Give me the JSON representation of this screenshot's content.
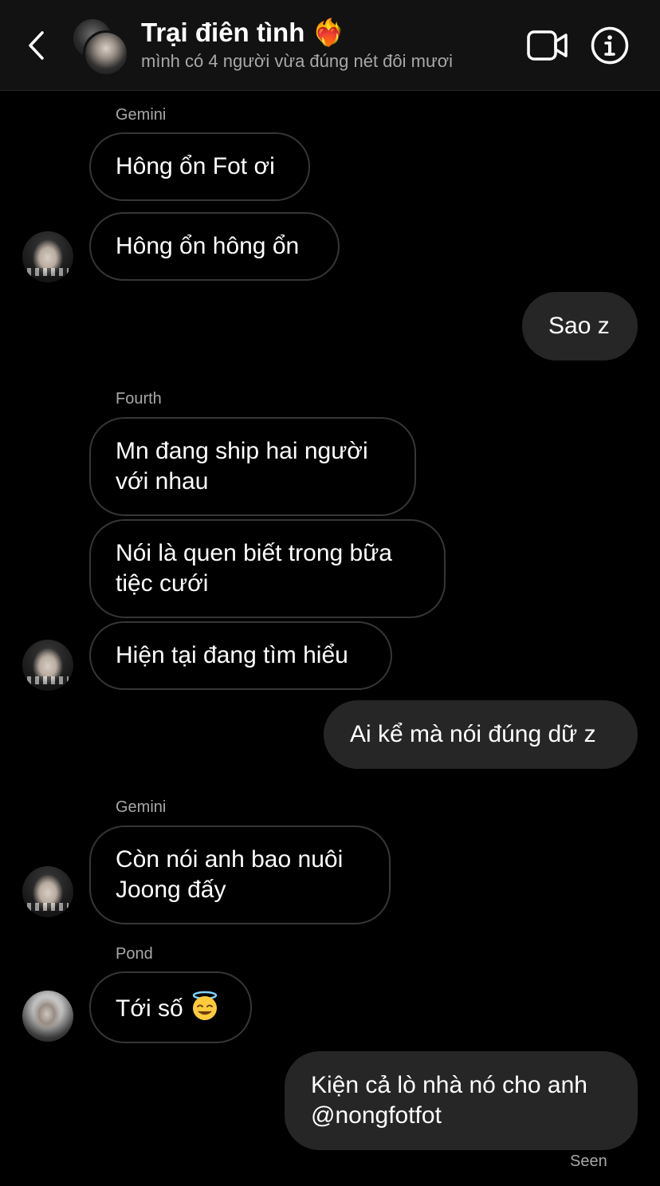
{
  "header": {
    "title": "Trại điên tình ❤️‍🔥",
    "subtitle": "mình có 4 người vừa đúng nét đôi mươi"
  },
  "messages": [
    {
      "sender": "Gemini",
      "text": "Hông ổn Fot ơi"
    },
    {
      "text": "Hông ổn hông ổn"
    },
    {
      "text": "Sao z"
    },
    {
      "sender": "Fourth",
      "line1": "Mn đang ship hai người",
      "line2": "với nhau"
    },
    {
      "line1": "Nói là quen biết trong bữa",
      "line2": "tiệc cưới"
    },
    {
      "text": "Hiện tại đang tìm hiểu"
    },
    {
      "text": "Ai kể mà nói đúng dữ z"
    },
    {
      "sender": "Gemini",
      "line1": "Còn nói anh bao nuôi",
      "line2": "Joong đấy"
    },
    {
      "sender": "Pond",
      "text": "Tới số"
    },
    {
      "line1": "Kiện cả lò nhà nó cho anh",
      "line2": "@nongfotfot"
    }
  ],
  "status": {
    "seen": "Seen"
  },
  "icons": {
    "back": "chevron-left-icon",
    "video": "video-camera-icon",
    "info": "info-icon",
    "emoji": "smiling-face-with-halo"
  },
  "colors": {
    "background": "#000000",
    "header": "#121212",
    "outgoing_bubble": "#262626",
    "incoming_border": "#363636",
    "secondary_text": "#a8a8a8"
  }
}
